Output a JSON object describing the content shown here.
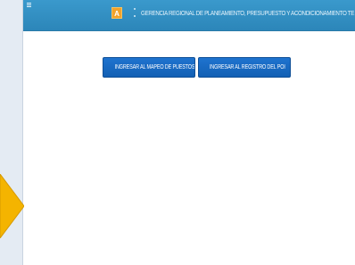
{
  "header": {
    "badge_text": "A",
    "title": "GERENCIA REGIONAL DE PLANEAMIENTO, PRESUPUESTO Y ACONDICIONAMIENTO TER"
  },
  "actions": {
    "mapeo_label": "INGRESAR AL MAPEO DE PUESTOS",
    "poi_label": "INGRESAR AL REGISTRO DEL POI"
  },
  "colors": {
    "header_bg": "#2f8fc4",
    "button_bg": "#1766c2",
    "badge_bg": "#f2a22a",
    "arrow_fill": "#f4b400"
  },
  "icons": {
    "menu": "hamburger-icon",
    "side_toggle": "chevron-left-icon"
  }
}
